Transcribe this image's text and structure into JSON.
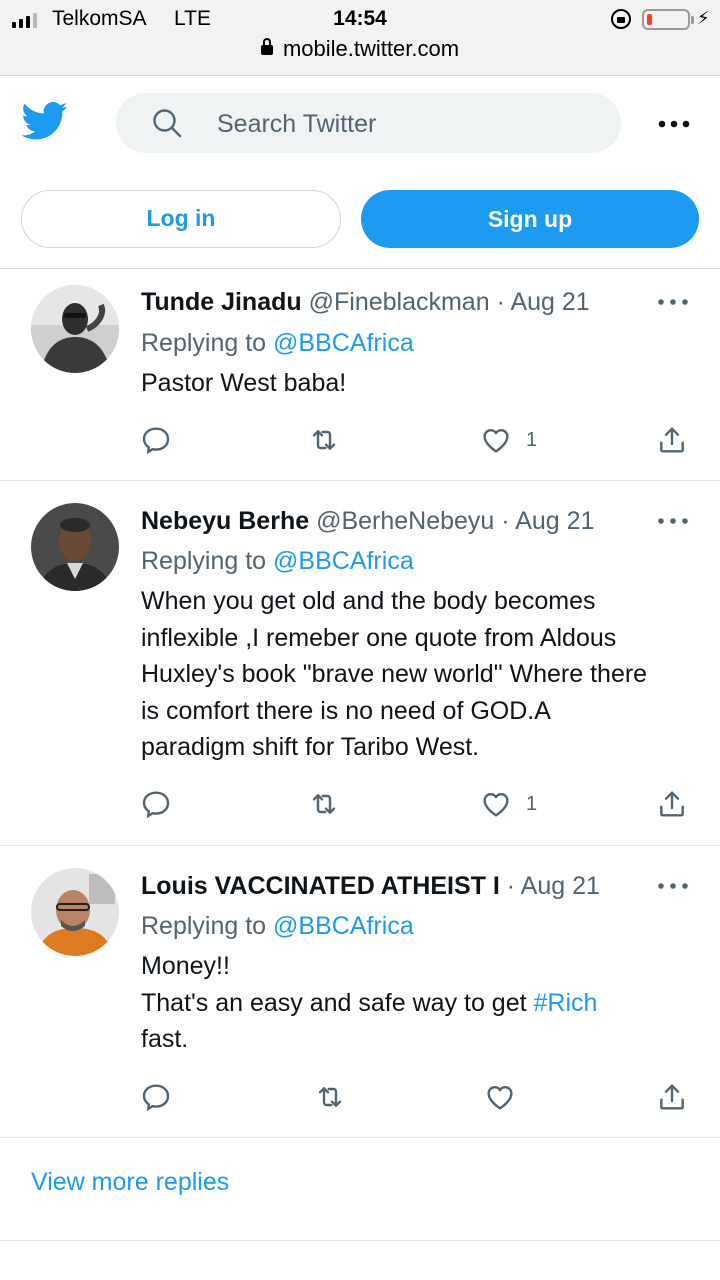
{
  "status_bar": {
    "carrier": "TelkomSA",
    "network": "LTE",
    "time": "14:54",
    "url": "mobile.twitter.com",
    "battery_color": "#ff3b30"
  },
  "header": {
    "logo_icon": "twitter-bird-icon",
    "search_placeholder": "Search Twitter",
    "more_icon": "more-horizontal-icon",
    "login_label": "Log in",
    "signup_label": "Sign up",
    "accent_color": "#1d9bf0"
  },
  "tweets": [
    {
      "name": "Tunde Jinadu",
      "handle": "@Fineblackman",
      "date": "· Aug 21",
      "replying_prefix": "Replying to",
      "replying_to": "@BBCAfrica",
      "text_lines": [
        "Pastor West baba!"
      ],
      "like_count": "1"
    },
    {
      "name": "Nebeyu Berhe",
      "handle": "@BerheNebeyu",
      "date": "· Aug 21",
      "replying_prefix": "Replying to",
      "replying_to": "@BBCAfrica",
      "text_lines": [
        "When you get old and the body becomes",
        "inflexible ,I remeber one quote from Aldous",
        "Huxley's book \"brave new world\" Where there",
        "is comfort there is no need of GOD.A",
        "paradigm shift for Taribo West."
      ],
      "like_count": "1"
    },
    {
      "name": "Louis VACCINATED ATHEIST I",
      "handle": "",
      "date": "· Aug 21",
      "replying_prefix": "Replying to",
      "replying_to": "@BBCAfrica",
      "text_lines": [
        "Money!!",
        "That's an easy and safe way to get ",
        "fast."
      ],
      "hashtag": "#Rich",
      "like_count": ""
    }
  ],
  "view_more_label": "View more replies"
}
